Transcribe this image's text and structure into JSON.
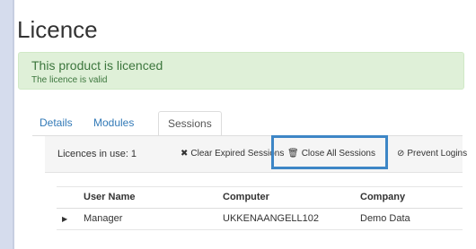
{
  "page": {
    "title": "Licence"
  },
  "alert": {
    "title": "This product is licenced",
    "subtitle": "The licence is valid"
  },
  "tabs": [
    {
      "label": "Details",
      "active": false
    },
    {
      "label": "Modules",
      "active": false
    },
    {
      "label": "Sessions",
      "active": true
    }
  ],
  "toolbar": {
    "licences_in_use": "Licences in use: 1",
    "clear_expired": "Clear Expired Sessions",
    "close_all": "Close All Sessions",
    "prevent_logins": "Prevent Logins"
  },
  "table": {
    "columns": [
      "User Name",
      "Computer",
      "Company"
    ],
    "rows": [
      {
        "user": "Manager",
        "computer": "UKKENAANGELL102",
        "company": "Demo Data"
      }
    ]
  }
}
